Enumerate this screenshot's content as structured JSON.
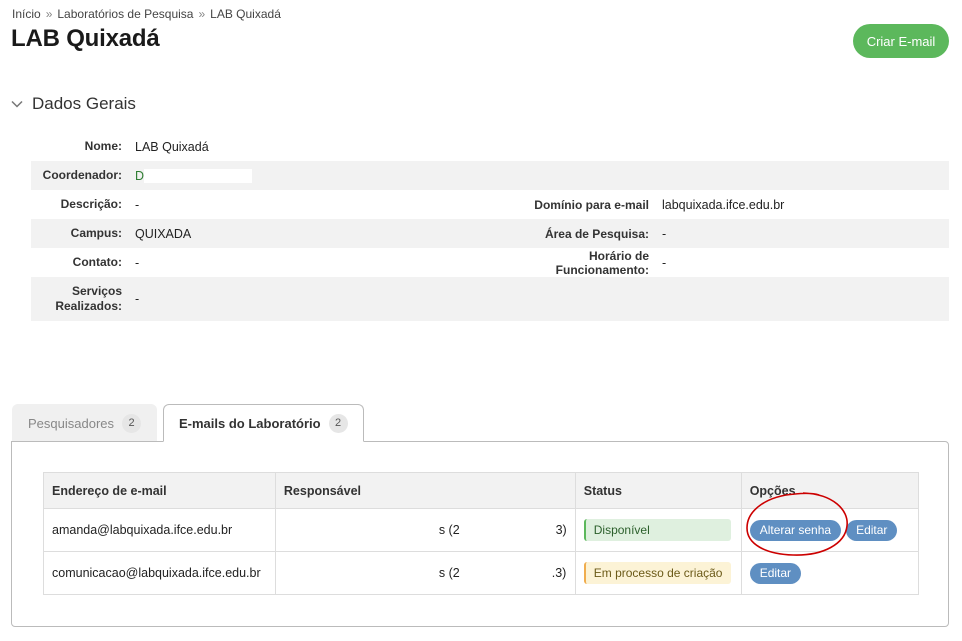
{
  "breadcrumb": {
    "home": "Início",
    "sep": "»",
    "labs": "Laboratórios de Pesquisa",
    "current": "LAB Quixadá"
  },
  "page_title": "LAB Quixadá",
  "create_email_button": "Criar E-mail",
  "section": {
    "title": "Dados Gerais"
  },
  "details": {
    "nome_label": "Nome:",
    "nome_value": "LAB Quixadá",
    "coord_label": "Coordenador:",
    "coord_value": "D",
    "descricao_label": "Descrição:",
    "descricao_value": "-",
    "dominio_label": "Domínio para e-mail",
    "dominio_value": "labquixada.ifce.edu.br",
    "campus_label": "Campus:",
    "campus_value": "QUIXADA",
    "area_label": "Área de Pesquisa:",
    "area_value": "-",
    "contato_label": "Contato:",
    "contato_value": "-",
    "horario_label": "Horário de Funcionamento:",
    "horario_value": "-",
    "servicos_label_1": "Serviços",
    "servicos_label_2": "Realizados:",
    "servicos_value": "-"
  },
  "tabs": [
    {
      "label": "Pesquisadores",
      "count": "2"
    },
    {
      "label": "E-mails do Laboratório",
      "count": "2"
    }
  ],
  "table": {
    "headers": [
      "Endereço de e-mail",
      "Responsável",
      "Status",
      "Opções"
    ],
    "rows": [
      {
        "email": "amanda@labquixada.ifce.edu.br",
        "resp_a": "s (2",
        "resp_b": "3)",
        "status": "Disponível",
        "btn1": "Alterar senha",
        "btn2": "Editar"
      },
      {
        "email": "comunicacao@labquixada.ifce.edu.br",
        "resp_a": "s (2",
        "resp_b": ".3)",
        "status": "Em processo de criação",
        "btn1": "Editar"
      }
    ]
  },
  "colors": {
    "green": "#5cb85c",
    "blue": "#5f8fc2",
    "annotation": "#cc0000"
  }
}
